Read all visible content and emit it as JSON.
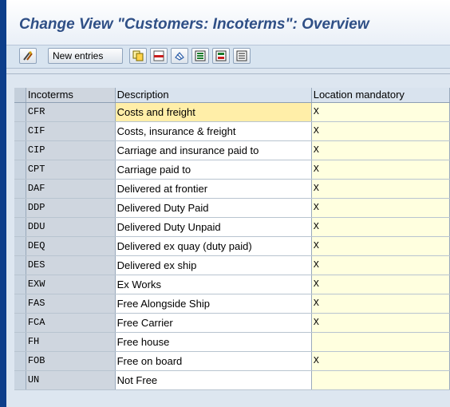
{
  "window": {
    "title": "Change View \"Customers: Incoterms\": Overview"
  },
  "toolbar": {
    "buttons": [
      {
        "icon": "display-change-icon"
      },
      {
        "label": "New entries"
      },
      {
        "icon": "copy-icon"
      },
      {
        "icon": "delete-icon"
      },
      {
        "icon": "undo-change-icon"
      },
      {
        "icon": "select-all-icon"
      },
      {
        "icon": "select-block-icon"
      },
      {
        "icon": "deselect-all-icon"
      }
    ]
  },
  "table": {
    "columns": [
      "Incoterms",
      "Description",
      "Location mandatory"
    ],
    "rows": [
      {
        "code": "CFR",
        "description": "Costs and freight",
        "location": "X"
      },
      {
        "code": "CIF",
        "description": "Costs, insurance & freight",
        "location": "X"
      },
      {
        "code": "CIP",
        "description": "Carriage and insurance paid to",
        "location": "X"
      },
      {
        "code": "CPT",
        "description": "Carriage paid to",
        "location": "X"
      },
      {
        "code": "DAF",
        "description": "Delivered at frontier",
        "location": "X"
      },
      {
        "code": "DDP",
        "description": "Delivered Duty Paid",
        "location": "X"
      },
      {
        "code": "DDU",
        "description": "Delivered Duty Unpaid",
        "location": "X"
      },
      {
        "code": "DEQ",
        "description": "Delivered ex quay (duty paid)",
        "location": "X"
      },
      {
        "code": "DES",
        "description": "Delivered ex ship",
        "location": "X"
      },
      {
        "code": "EXW",
        "description": "Ex Works",
        "location": "X"
      },
      {
        "code": "FAS",
        "description": "Free Alongside Ship",
        "location": "X"
      },
      {
        "code": "FCA",
        "description": "Free Carrier",
        "location": "X"
      },
      {
        "code": "FH",
        "description": "Free house",
        "location": ""
      },
      {
        "code": "FOB",
        "description": "Free on board",
        "location": "X"
      },
      {
        "code": "UN",
        "description": "Not Free",
        "location": ""
      }
    ]
  },
  "colors": {
    "title_text": "#2f4f86",
    "frame": "#0d3e8a",
    "focused_cell": "#ffeea8",
    "input_cell": "#ffffdf"
  }
}
